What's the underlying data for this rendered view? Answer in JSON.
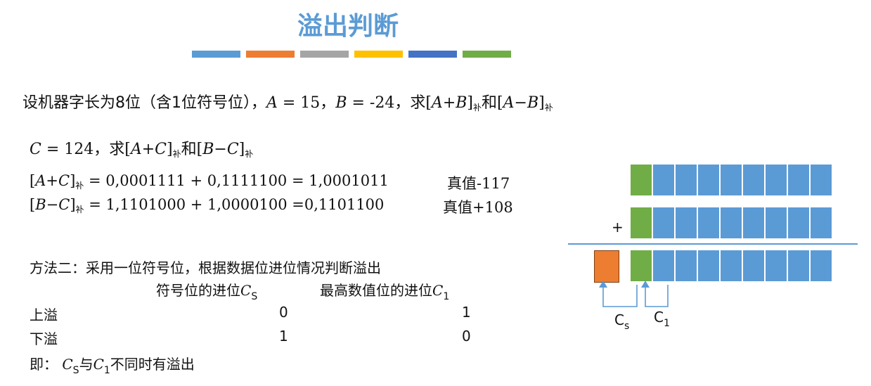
{
  "title": "溢出判断",
  "colors": {
    "title": "#5b9bd5",
    "bar": [
      "#5b9bd5",
      "#ed7d31",
      "#a5a5a5",
      "#ffc000",
      "#4472c4",
      "#70ad47"
    ],
    "cell_data": "#5b9bd5",
    "cell_sign": "#70ad47",
    "cell_carry": "#ed7d31"
  },
  "problem": {
    "p1": "设机器字长为8位（含1位符号位），",
    "A": "A",
    "eq15": " = 15，",
    "B": "B",
    "eqm24": " = -24，求[",
    "APB": "A",
    "plus": "+",
    "BB": "B",
    "close1": "]",
    "bu": "补",
    "and": "和[",
    "AM": "A",
    "minus": "−",
    "BM": "B",
    "close2": "]"
  },
  "line2": {
    "C": "C",
    "rest": " = 124，求[",
    "A": "A",
    "plus": "+",
    "C2": "C",
    "close": "]",
    "bu": "补",
    "and": "和[",
    "B": "B",
    "minus": "−",
    "C3": "C",
    "close2": "]",
    "bu2": "补"
  },
  "calc1": {
    "lhs_open": "[",
    "A": "A",
    "plus": "+",
    "C": "C",
    "close": "]",
    "bu": "补",
    "expr": " = 0,0001111 + 0,1111100 = 1,0001011",
    "truth": "真值-117"
  },
  "calc2": {
    "lhs_open": "[",
    "B": "B",
    "minus": "−",
    "C": "C",
    "close": "]",
    "bu": "补",
    "expr": " = 1,1101000 + 1,0000100 =0,1101100",
    "truth": "真值+108"
  },
  "method": {
    "heading": "方法二：采用一位符号位，根据数据位进位情况判断溢出",
    "col1": "符号位的进位",
    "col1_sym": "C",
    "col1_sub": "S",
    "col2": "最高数值位的进位",
    "col2_sym": "C",
    "col2_sub": "1",
    "rows": [
      {
        "label": "上溢",
        "cs": "0",
        "c1": "1"
      },
      {
        "label": "下溢",
        "cs": "1",
        "c1": "0"
      }
    ],
    "conclusion_pre": "即：",
    "conc_cs": "C",
    "conc_cs_sub": "S",
    "conc_mid": "与",
    "conc_c1": "C",
    "conc_c1_sub": "1",
    "conc_post": "不同时有溢出"
  },
  "diagram": {
    "plus": "+",
    "label_cs": "C",
    "label_cs_sub": "s",
    "label_c1": "C",
    "label_c1_sub": "1"
  }
}
